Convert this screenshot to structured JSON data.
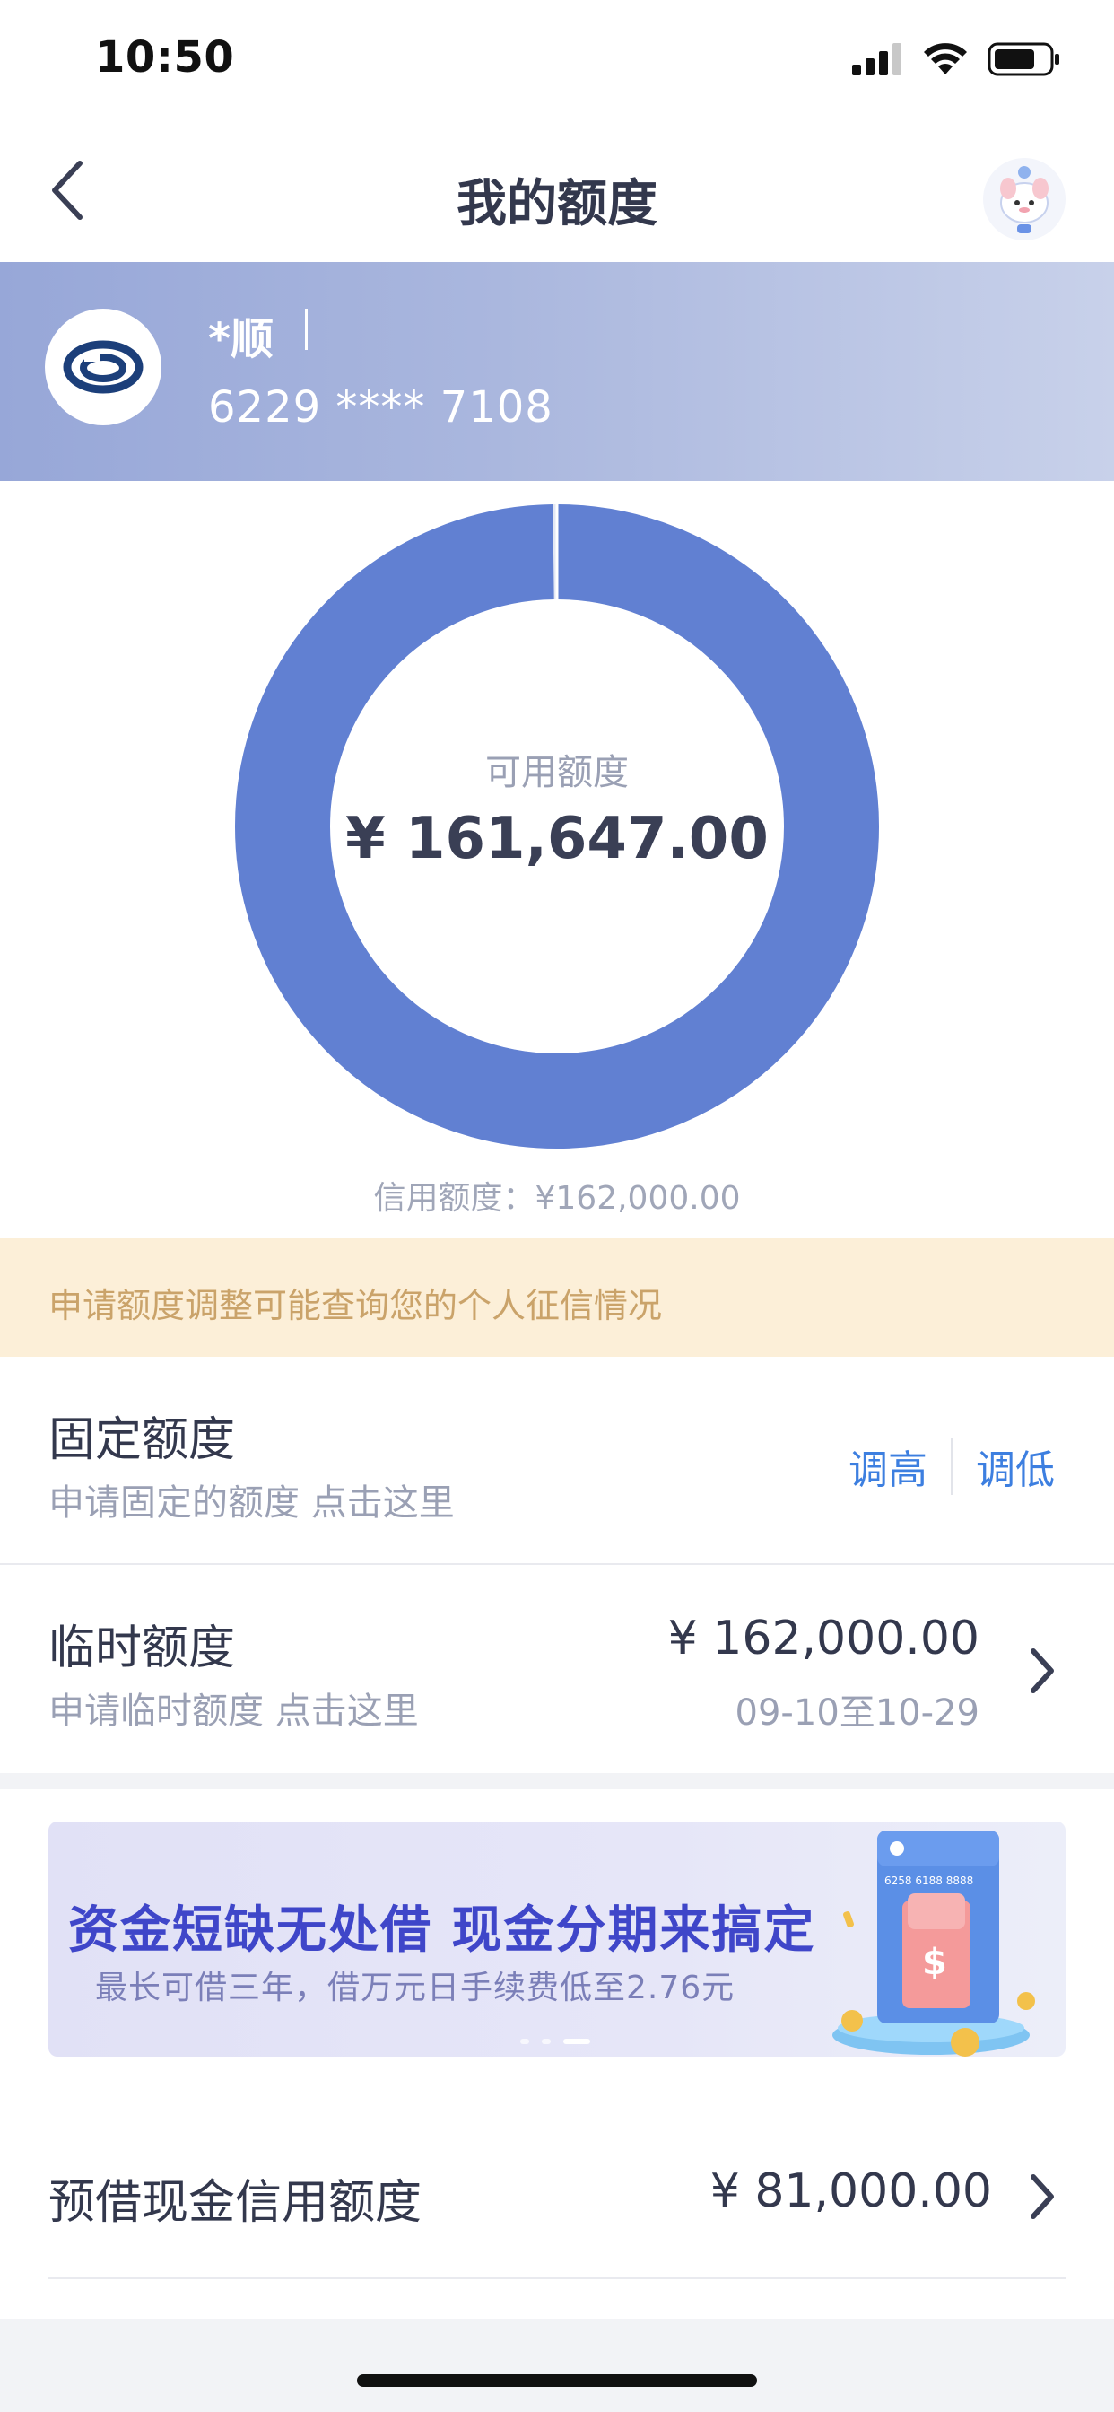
{
  "status_bar": {
    "time": "10:50"
  },
  "nav": {
    "title": "我的额度"
  },
  "card": {
    "name": "*顺",
    "number": "6229 **** 7108"
  },
  "donut": {
    "label": "可用额度",
    "amount": "¥ 161,647.00",
    "available_fraction": 0.9978,
    "color": "#6180d2",
    "credit_limit_text": "信用额度：¥162,000.00"
  },
  "notice": {
    "text": "申请额度调整可能查询您的个人征信情况"
  },
  "fixed_limit": {
    "title": "固定额度",
    "subtitle": "申请固定的额度 点击这里",
    "increase_label": "调高",
    "decrease_label": "调低"
  },
  "temp_limit": {
    "title": "临时额度",
    "subtitle": "申请临时额度 点击这里",
    "amount": "¥ 162,000.00",
    "date_range": "09-10至10-29"
  },
  "banner": {
    "headline": "资金短缺无处借 现金分期来搞定",
    "subtitle": "最长可借三年，借万元日手续费低至2.76元",
    "card_number": "6258 6188 8888"
  },
  "preloan": {
    "title": "预借现金信用额度",
    "amount": "¥ 81,000.00"
  }
}
